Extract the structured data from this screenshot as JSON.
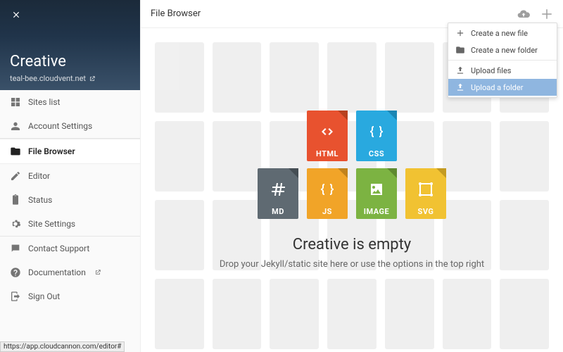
{
  "sidebar": {
    "title": "Creative",
    "subtitle": "teal-bee.cloudvent.net",
    "items": [
      {
        "label": "Sites list",
        "icon": "grid"
      },
      {
        "label": "Account Settings",
        "icon": "account"
      },
      {
        "label": "File Browser",
        "icon": "folder",
        "active": true
      },
      {
        "label": "Editor",
        "icon": "pencil"
      },
      {
        "label": "Status",
        "icon": "clipboard"
      },
      {
        "label": "Site Settings",
        "icon": "gear"
      },
      {
        "label": "Contact Support",
        "icon": "chat"
      },
      {
        "label": "Documentation",
        "icon": "help",
        "external": true
      },
      {
        "label": "Sign Out",
        "icon": "exit"
      }
    ]
  },
  "topbar": {
    "title": "File Browser"
  },
  "dropdown": {
    "items": [
      {
        "label": "Create a new file",
        "icon": "plus"
      },
      {
        "label": "Create a new folder",
        "icon": "folder-plus"
      },
      {
        "label": "Upload files",
        "icon": "upload"
      },
      {
        "label": "Upload a folder",
        "icon": "upload",
        "highlighted": true
      }
    ]
  },
  "files": {
    "row1": [
      "HTML",
      "CSS"
    ],
    "row2": [
      "MD",
      "JS",
      "IMAGE",
      "SVG"
    ]
  },
  "empty": {
    "title": "Creative is empty",
    "subtitle": "Drop your Jekyll/static site here or use the options in the top right"
  },
  "statusbar": "https://app.cloudcannon.com/editor#"
}
